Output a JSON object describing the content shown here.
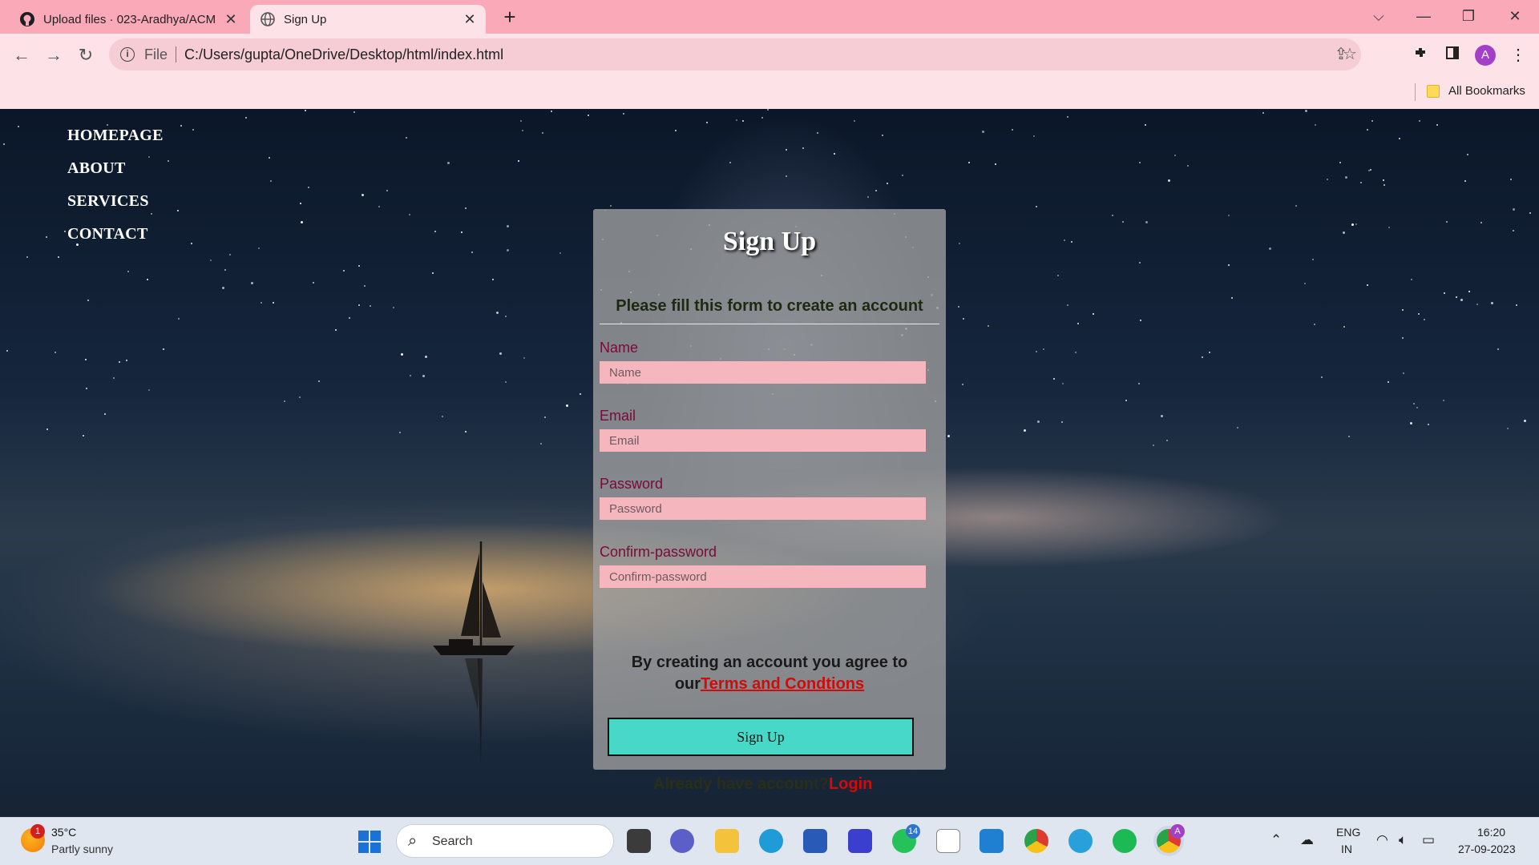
{
  "browser": {
    "tabs": [
      {
        "title": "Upload files · 023-Aradhya/ACM",
        "active": false,
        "close": "✕"
      },
      {
        "title": "Sign Up",
        "active": true,
        "close": "✕"
      }
    ],
    "new_tab": "+",
    "window_controls": {
      "dropdown": "⌵",
      "minimize": "—",
      "restore": "❐",
      "close": "✕"
    },
    "nav": {
      "back": "←",
      "forward": "→",
      "reload": "↻"
    },
    "address": {
      "scheme": "File",
      "url": "C:/Users/gupta/OneDrive/Desktop/html/index.html"
    },
    "profile_initial": "A",
    "bookmarks_label": "All Bookmarks"
  },
  "site": {
    "nav": [
      "HOMEPAGE",
      "ABOUT",
      "SERVICES",
      "CONTACT"
    ],
    "form": {
      "title": "Sign Up",
      "subtitle": "Please fill this form to create an account",
      "fields": [
        {
          "label": "Name",
          "placeholder": "Name"
        },
        {
          "label": "Email",
          "placeholder": "Email"
        },
        {
          "label": "Password",
          "placeholder": "Password"
        },
        {
          "label": "Confirm-password",
          "placeholder": "Confirm-password"
        }
      ],
      "terms_prefix": "By creating an account you agree to our",
      "terms_link": "Terms and Condtions",
      "submit_label": "Sign Up",
      "login_prefix": "Already have account?",
      "login_link": "Login"
    },
    "colors": {
      "button": "#48d8c8",
      "input_bg": "#f6b6be",
      "link": "#cf0b0b",
      "label": "#7a0a3a"
    }
  },
  "taskbar": {
    "weather": {
      "temp": "35°C",
      "desc": "Partly sunny",
      "badge": "1"
    },
    "search_text": "Search",
    "whatsapp_badge": "14",
    "chrome_badge": "A",
    "language": {
      "line1": "ENG",
      "line2": "IN"
    },
    "clock": {
      "time": "16:20",
      "date": "27-09-2023"
    }
  }
}
